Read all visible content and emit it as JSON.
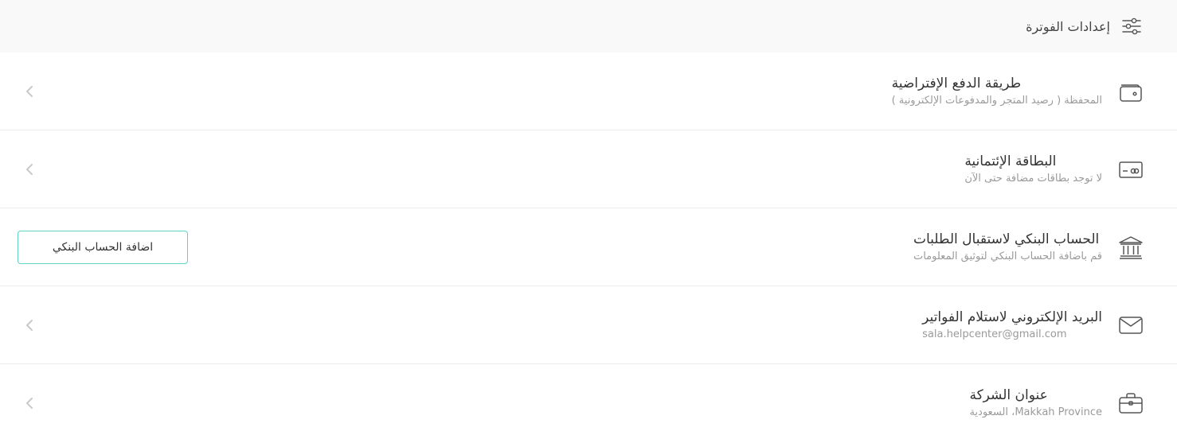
{
  "header": {
    "title": "إعدادات الفوترة",
    "icon": "sliders-icon"
  },
  "rows": [
    {
      "title": "طريقة الدفع الإفتراضية",
      "subtitle": "المحفظة ( رصيد المتجر والمدفوعات الإلكترونية )",
      "icon": "wallet-icon",
      "action": "chevron"
    },
    {
      "title": "البطاقة الإئتمانية",
      "subtitle": "لا توجد بطاقات مضافة حتى الآن",
      "icon": "credit-card-icon",
      "action": "chevron"
    },
    {
      "title": "الحساب البنكي لاستقبال الطلبات",
      "subtitle": "قم باضافة الحساب البنكي لتوثيق المعلومات",
      "icon": "bank-icon",
      "action": "button",
      "button_label": "اضافة الحساب البنكي"
    },
    {
      "title": "البريد الإلكتروني لاستلام الفواتير",
      "subtitle": "sala.helpcenter@gmail.com",
      "icon": "envelope-icon",
      "action": "chevron"
    },
    {
      "title": "عنوان الشركة",
      "subtitle": "Makkah Province، السعودية",
      "icon": "briefcase-icon",
      "action": "chevron"
    }
  ],
  "colors": {
    "accent_border": "#5fd3c6",
    "header_bg": "#f9f9f9",
    "divider": "#ececec",
    "muted_text": "#9a9a9a"
  }
}
